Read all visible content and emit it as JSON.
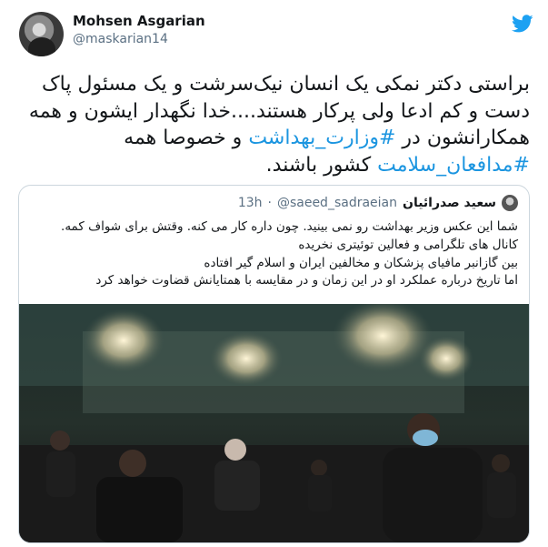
{
  "author": {
    "name": "Mohsen Asgarian",
    "handle": "@maskarian14"
  },
  "tweet": {
    "text_part1": "براستی دکتر نمکی یک انسان نیک‌سرشت و یک مسئول پاک دست و کم ادعا ولی پرکار هستند....خدا نگهدار ایشون و همه همکارانشون در ",
    "hashtag1": "#وزارت_بهداشت",
    "text_part2": " و خصوصا همه ",
    "hashtag2": "#مدافعان_سلامت",
    "text_part3": " کشور باشند."
  },
  "quoted_tweet": {
    "name": "سعید صدرائیان",
    "handle": "@saeed_sadraeian",
    "separator": "·",
    "time": "13h",
    "lines": [
      "شما این عکس وزیر بهداشت رو نمی بینید. چون داره کار می کنه. وقتش برای شواف کمه.",
      "کانال های تلگرامی و فعالین توئیتری نخریده",
      "بین گازانبر مافیای پزشکان و مخالفین ایران و اسلام گیر افتاده",
      "اما تاریخ درباره عملکرد او در این زمان و در مقایسه با همتایانش قضاوت خواهد کرد"
    ]
  },
  "colors": {
    "hashtag": "#1b95e0",
    "twitter_blue": "#1da1f2",
    "secondary_text": "#5b7083",
    "border": "#ccd6dd"
  },
  "icons": {
    "logo": "twitter-bird-icon"
  }
}
